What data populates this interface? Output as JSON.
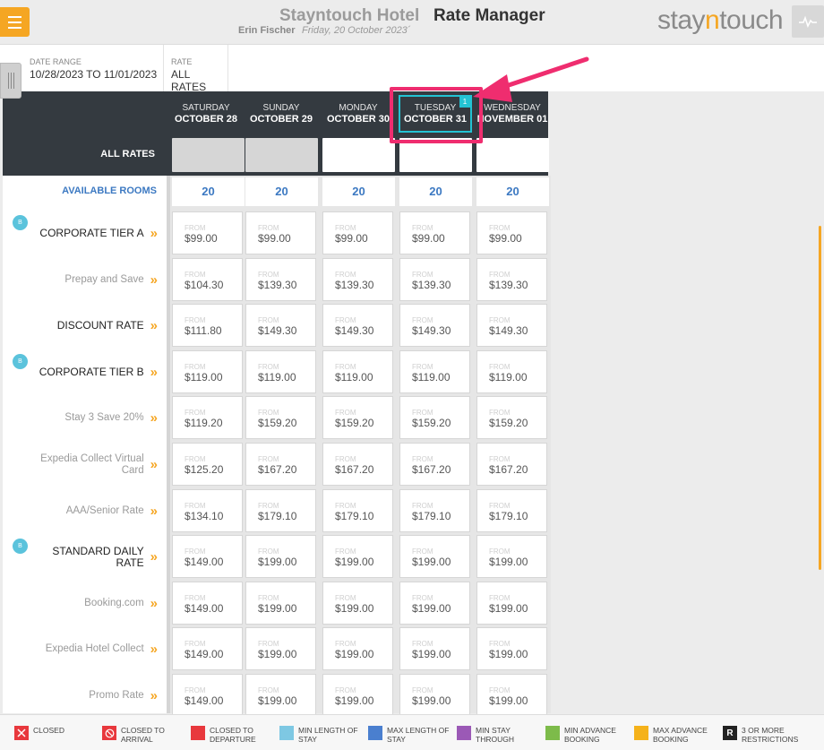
{
  "header": {
    "hotel_name": "Stayntouch Hotel",
    "page_title": "Rate Manager",
    "user_name": "Erin Fischer",
    "business_date": "Friday, 20 October 2023´",
    "brand_left": "stay",
    "brand_mid": "n",
    "brand_right": "touch"
  },
  "filters": {
    "date_range_label": "DATE RANGE",
    "date_range_value": "10/28/2023 TO 11/01/2023",
    "rate_label": "RATE",
    "rate_value": "ALL RATES"
  },
  "days": [
    {
      "dow": "SATURDAY",
      "date": "OCTOBER 28",
      "available": "20"
    },
    {
      "dow": "SUNDAY",
      "date": "OCTOBER 29",
      "available": "20"
    },
    {
      "dow": "MONDAY",
      "date": "OCTOBER 30",
      "available": "20"
    },
    {
      "dow": "TUESDAY",
      "date": "OCTOBER 31",
      "available": "20",
      "badge": "1"
    },
    {
      "dow": "WEDNESDAY",
      "date": "NOVEMBER 01",
      "available": "20"
    }
  ],
  "all_rates_label": "ALL RATES",
  "available_rooms_label": "AVAILABLE ROOMS",
  "from_label": "FROM",
  "base_badge": "B",
  "rates": [
    {
      "name": "CORPORATE TIER A",
      "base": true,
      "prices": [
        "$99.00",
        "$99.00",
        "$99.00",
        "$99.00",
        "$99.00"
      ]
    },
    {
      "name": "Prepay and Save",
      "base": false,
      "prices": [
        "$104.30",
        "$139.30",
        "$139.30",
        "$139.30",
        "$139.30"
      ]
    },
    {
      "name": "DISCOUNT RATE",
      "base": false,
      "prices": [
        "$111.80",
        "$149.30",
        "$149.30",
        "$149.30",
        "$149.30"
      ]
    },
    {
      "name": "CORPORATE TIER B",
      "base": true,
      "prices": [
        "$119.00",
        "$119.00",
        "$119.00",
        "$119.00",
        "$119.00"
      ]
    },
    {
      "name": "Stay 3 Save 20%",
      "base": false,
      "prices": [
        "$119.20",
        "$159.20",
        "$159.20",
        "$159.20",
        "$159.20"
      ]
    },
    {
      "name": "Expedia Collect Virtual Card",
      "base": false,
      "prices": [
        "$125.20",
        "$167.20",
        "$167.20",
        "$167.20",
        "$167.20"
      ]
    },
    {
      "name": "AAA/Senior Rate",
      "base": false,
      "prices": [
        "$134.10",
        "$179.10",
        "$179.10",
        "$179.10",
        "$179.10"
      ]
    },
    {
      "name": "STANDARD DAILY RATE",
      "base": true,
      "prices": [
        "$149.00",
        "$199.00",
        "$199.00",
        "$199.00",
        "$199.00"
      ]
    },
    {
      "name": "Booking.com",
      "base": false,
      "prices": [
        "$149.00",
        "$199.00",
        "$199.00",
        "$199.00",
        "$199.00"
      ]
    },
    {
      "name": "Expedia Hotel Collect",
      "base": false,
      "prices": [
        "$149.00",
        "$199.00",
        "$199.00",
        "$199.00",
        "$199.00"
      ]
    },
    {
      "name": "Promo Rate",
      "base": false,
      "prices": [
        "$149.00",
        "$199.00",
        "$199.00",
        "$199.00",
        "$199.00"
      ]
    }
  ],
  "legend": [
    {
      "label": "CLOSED",
      "color": "#e8383d",
      "icon": "x-icon"
    },
    {
      "label": "CLOSED TO ARRIVAL",
      "color": "#e8383d",
      "icon": "no-entry-icon"
    },
    {
      "label": "CLOSED TO DEPARTURE",
      "color": "#e8383d",
      "icon": ""
    },
    {
      "label": "MIN LENGTH OF STAY",
      "color": "#7ec8e3",
      "icon": ""
    },
    {
      "label": "MAX LENGTH OF STAY",
      "color": "#4a7fcf",
      "icon": ""
    },
    {
      "label": "MIN STAY THROUGH",
      "color": "#9b59b6",
      "icon": ""
    },
    {
      "label": "MIN ADVANCE BOOKING",
      "color": "#7dbb4a",
      "icon": ""
    },
    {
      "label": "MAX ADVANCE BOOKING",
      "color": "#f5b21a",
      "icon": ""
    },
    {
      "label": "3 OR MORE RESTRICTIONS",
      "color": "#222222",
      "icon": "R"
    }
  ]
}
